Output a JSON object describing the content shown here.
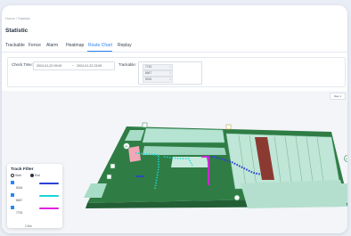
{
  "breadcrumb": "Home / Statistic",
  "page_title": "Statistic",
  "tabs": [
    {
      "label": "Trackable"
    },
    {
      "label": "Fence"
    },
    {
      "label": "Alarm"
    },
    {
      "label": "Heatmap"
    },
    {
      "label": "Route Chart"
    },
    {
      "label": "Replay"
    }
  ],
  "active_tab": "Route Chart",
  "filter": {
    "check_time_label": "Check Time:",
    "start_time": "2024-01-22 09:00",
    "separator": "~",
    "end_time": "2024-01-22 23:59",
    "trackable_label": "Trackable:",
    "selected": [
      "7715",
      "8467",
      "5016"
    ]
  },
  "map_tag": "Map 1",
  "legend": {
    "title": "Track Filter",
    "options": [
      "Start",
      "End"
    ],
    "tracks": [
      {
        "id": "5016",
        "color": "#2b3fd6"
      },
      {
        "id": "8467",
        "color": "#19d6d6"
      },
      {
        "id": "7715",
        "color": "#e020e0"
      }
    ]
  },
  "scale_label": "2.8m",
  "colors": {
    "accent": "#2a84f7",
    "floor": "#2f7d45",
    "racks": "#a7dcc6",
    "red_block": "#8b3a32"
  }
}
